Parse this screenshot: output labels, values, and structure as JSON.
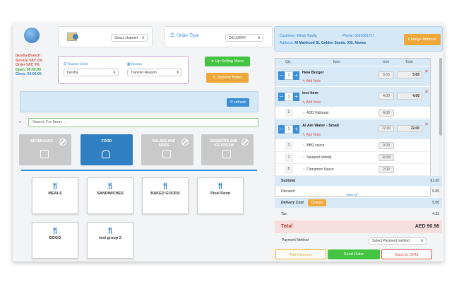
{
  "branch": {
    "name": "barsha Branch",
    "service_vat": "Service VAT: 0%",
    "order_vat": "Order VAT: 0%",
    "open": "Open: 00:00:00",
    "close": "Close: 00:00:00"
  },
  "channel": {
    "placeholder": "Select channel"
  },
  "order_type": {
    "label": "Order Type",
    "value": "DELIVERY"
  },
  "transfer": {
    "order_label": "Transfer Order",
    "order_value": "barsha",
    "reason_label": "Reason",
    "reason_value": "Transfer Reason"
  },
  "buttons": {
    "upselling": "Up-Selling Menu",
    "delivery_notes": "Delivery Notes",
    "refresh": "refresh",
    "change_address": "Change Address"
  },
  "search": {
    "placeholder": "Search For Items ..."
  },
  "categories": [
    {
      "label": "BEVERAGES"
    },
    {
      "label": "FOOD"
    },
    {
      "label": "SALADS AND SIDES"
    },
    {
      "label": "DESSERTS AND ICE CREAM"
    }
  ],
  "groups": [
    {
      "label": "MEALS"
    },
    {
      "label": "SANDWICHES"
    },
    {
      "label": "BAKED GOODS"
    },
    {
      "label": "Pixel Point"
    },
    {
      "label": "BOGO"
    },
    {
      "label": "test group 2"
    }
  ],
  "customer": {
    "name_label": "Customer:",
    "name": "Elhab Tawfig",
    "phone_label": "Phone:",
    "phone": "0581081717",
    "address_label": "Address:",
    "address": "Al Manhood St, Golden Sands, 305, Newss"
  },
  "order_table": {
    "headers": {
      "qty": "Qty",
      "item": "Item",
      "unit": "Unit",
      "total": "Total"
    },
    "add_note": "Add Note",
    "items": [
      {
        "qty": "1",
        "name": "New Burger",
        "unit": "5.65",
        "total": "5.65",
        "mods": []
      },
      {
        "qty": "1",
        "name": "test item",
        "unit": "4.00",
        "total": "4.00",
        "mods": [
          {
            "qty": "1",
            "name": "ADD Halloumi",
            "unit": "4.00"
          }
        ]
      },
      {
        "qty": "1",
        "name": "Al Ain Water - Small",
        "unit": "72.00",
        "total": "72.00",
        "mods": [
          {
            "qty": "1",
            "name": "BBQ sauce",
            "unit": "0.00"
          },
          {
            "qty": "1",
            "name": "Sauteed shrimp",
            "unit": "10.00"
          },
          {
            "qty": "0",
            "name": "Cinnamon Sauce",
            "unit": "2.00"
          }
        ]
      }
    ],
    "view_all": "View All"
  },
  "summary": {
    "subtotal_label": "Subtotal",
    "subtotal": "81.65",
    "discount_label": "Discount",
    "discount": "0.00",
    "delivery_label": "Delivery Cost",
    "delivery_change": "Change",
    "delivery": "5.00",
    "tax_label": "Tax",
    "tax": "4.33",
    "total_label": "Total",
    "total": "AED 90.98",
    "payment_label": "Payment Method",
    "payment_value": "Select Payment method"
  },
  "footer": {
    "add_discount": "Add Discount",
    "send_order": "Send Order",
    "back": "Back to CRM"
  },
  "colors": {
    "blue": "#3b8fd8",
    "green": "#45c444",
    "orange": "#f0a73a",
    "gray_cat": "#c9c9c9",
    "active_cat": "#2f7fc1",
    "total_bg": "#f7dede"
  }
}
